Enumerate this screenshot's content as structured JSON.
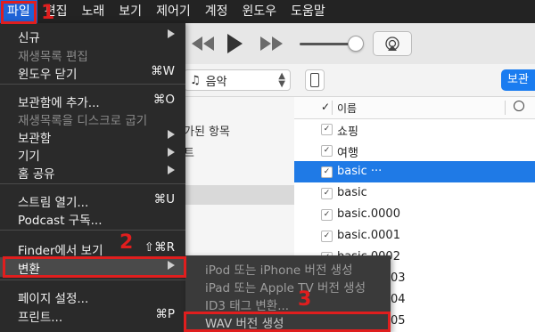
{
  "menubar": {
    "items": [
      "파일",
      "편집",
      "노래",
      "보기",
      "제어기",
      "계정",
      "윈도우",
      "도움말"
    ]
  },
  "toolbar": {
    "rewind_icon": "rewind-icon",
    "play_icon": "play-icon",
    "forward_icon": "fast-forward-icon",
    "airplay_icon": "airplay-icon"
  },
  "navbar": {
    "media_label": "음악",
    "store_label": "보관"
  },
  "sidebar": {
    "texts": [
      "가된 항목",
      "트"
    ]
  },
  "list": {
    "header_name": "이름",
    "rows": [
      {
        "title": "쇼핑"
      },
      {
        "title": "여행"
      },
      {
        "title": "basic ···"
      },
      {
        "title": "basic"
      },
      {
        "title": "basic.0000"
      },
      {
        "title": "basic.0001"
      },
      {
        "title": "basic.0002"
      }
    ],
    "partial_rows": [
      "03",
      "04",
      "05"
    ]
  },
  "file_menu": {
    "items": [
      {
        "label": "신규",
        "shortcut": "",
        "submenu": true,
        "disabled": false
      },
      {
        "label": "재생목록 편집",
        "shortcut": "",
        "submenu": false,
        "disabled": true
      },
      {
        "label": "윈도우 닫기",
        "shortcut": "⌘W",
        "submenu": false,
        "disabled": false
      },
      {
        "label": "보관함에 추가...",
        "shortcut": "⌘O",
        "submenu": false,
        "disabled": false
      },
      {
        "label": "재생목록을 디스크로 굽기",
        "shortcut": "",
        "submenu": false,
        "disabled": true
      },
      {
        "label": "보관함",
        "shortcut": "",
        "submenu": true,
        "disabled": false
      },
      {
        "label": "기기",
        "shortcut": "",
        "submenu": true,
        "disabled": false
      },
      {
        "label": "홈 공유",
        "shortcut": "",
        "submenu": true,
        "disabled": false
      },
      {
        "label": "스트림 열기...",
        "shortcut": "⌘U",
        "submenu": false,
        "disabled": false
      },
      {
        "label": "Podcast 구독...",
        "shortcut": "",
        "submenu": false,
        "disabled": false
      },
      {
        "label": "Finder에서 보기",
        "shortcut": "⇧⌘R",
        "submenu": false,
        "disabled": false
      },
      {
        "label": "변환",
        "shortcut": "",
        "submenu": true,
        "disabled": false
      },
      {
        "label": "페이지 설정...",
        "shortcut": "",
        "submenu": false,
        "disabled": false
      },
      {
        "label": "프린트...",
        "shortcut": "⌘P",
        "submenu": false,
        "disabled": false
      }
    ]
  },
  "convert_submenu": {
    "items": [
      "iPod 또는 iPhone 버전 생성",
      "iPad 또는 Apple TV 버전 생성",
      "ID3 태그 변환...",
      "WAV 버전 생성"
    ]
  },
  "annotations": {
    "labels": [
      "1",
      "2",
      "3"
    ],
    "color": "#e01e1e"
  }
}
